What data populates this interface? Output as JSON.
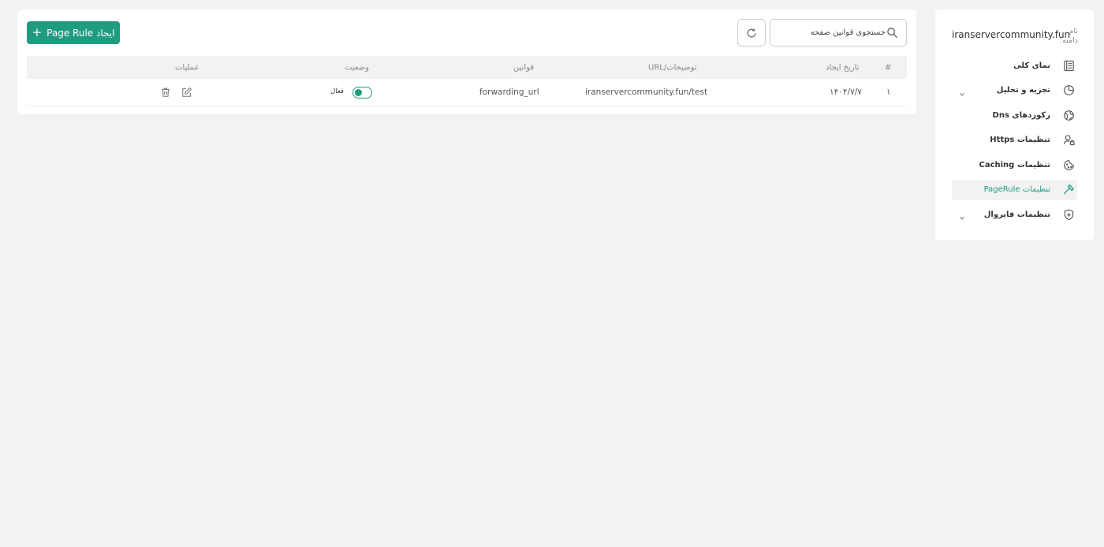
{
  "sidebar": {
    "domain_label": "نام دامنه:",
    "domain_value": "iranservercommunity.fun",
    "items": [
      {
        "label": "نمای کلی",
        "icon": "overview-icon",
        "has_chevron": false,
        "active": false
      },
      {
        "label": "تجزیه و تحلیل",
        "icon": "chart-pie-icon",
        "has_chevron": true,
        "active": false
      },
      {
        "label": "رکوردهای Dns",
        "icon": "globe-icon",
        "has_chevron": false,
        "active": false
      },
      {
        "label": "تنظیمات Https",
        "icon": "user-lock-icon",
        "has_chevron": false,
        "active": false
      },
      {
        "label": "تنظیمات Caching",
        "icon": "cookie-icon",
        "has_chevron": false,
        "active": false
      },
      {
        "label": "تنظیمات PageRule",
        "icon": "hammer-icon",
        "has_chevron": false,
        "active": true
      },
      {
        "label": "تنظیمات فایروال",
        "icon": "shield-icon",
        "has_chevron": true,
        "active": false
      }
    ]
  },
  "toolbar": {
    "create_label": "ایجاد Page Rule",
    "search_placeholder": "جستجوی قوانین صفحه"
  },
  "accent_color": "#1e9c7f",
  "table": {
    "headers": {
      "index": "#",
      "created": "تاریخ ایجاد",
      "url": "URL/توضیحات",
      "rules": "قوانین",
      "status": "وضعیت",
      "ops": "عملیات"
    },
    "rows": [
      {
        "index": "۱",
        "created": "۱۴۰۴/۷/۷",
        "url": "iranservercommunity.fun/test",
        "rules": "forwarding_url",
        "status": "فعال",
        "enabled": true
      }
    ]
  }
}
